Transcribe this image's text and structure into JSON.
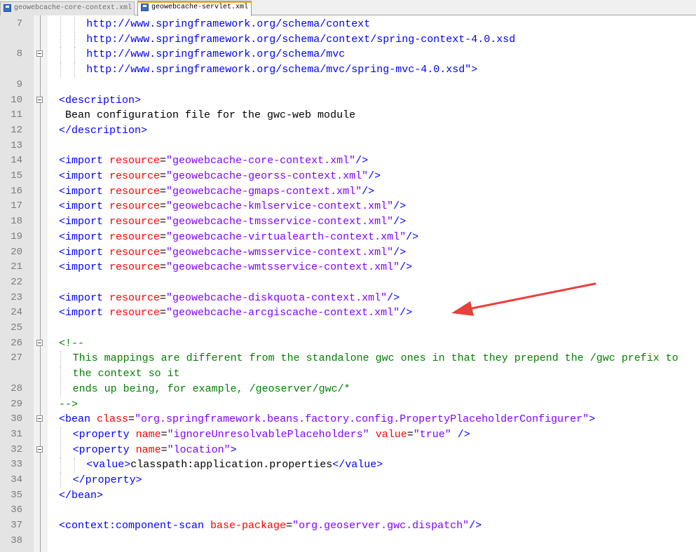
{
  "tabs": [
    {
      "label": "geowebcache-core-context.xml",
      "active": false
    },
    {
      "label": "geowebcache-servlet.xml",
      "active": true
    }
  ],
  "lines": [
    {
      "num": "7",
      "indent": 2,
      "fold": false,
      "spans": [
        {
          "t": "http://www.springframework.org/schema/context",
          "c": "tag"
        }
      ]
    },
    {
      "num": "",
      "indent": 2,
      "fold": false,
      "spans": [
        {
          "t": "http://www.springframework.org/schema/context/spring-context-4.0.xsd",
          "c": "tag"
        }
      ]
    },
    {
      "num": "8",
      "indent": 2,
      "fold": true,
      "spans": [
        {
          "t": "http://www.springframework.org/schema/mvc",
          "c": "tag"
        }
      ]
    },
    {
      "num": "",
      "indent": 2,
      "fold": false,
      "spans": [
        {
          "t": "http://www.springframework.org/schema/mvc/spring-mvc-4.0.xsd\">",
          "c": "tag"
        }
      ]
    },
    {
      "num": "9",
      "indent": 0,
      "fold": false,
      "spans": []
    },
    {
      "num": "10",
      "indent": 0,
      "fold": true,
      "spans": [
        {
          "t": "<description>",
          "c": "tag"
        }
      ]
    },
    {
      "num": "11",
      "indent": 0,
      "fold": false,
      "spans": [
        {
          "t": " Bean configuration file for the gwc-web module",
          "c": "plain"
        }
      ]
    },
    {
      "num": "12",
      "indent": 0,
      "fold": false,
      "spans": [
        {
          "t": "</description>",
          "c": "tag"
        }
      ]
    },
    {
      "num": "13",
      "indent": 0,
      "fold": false,
      "spans": []
    },
    {
      "num": "14",
      "indent": 0,
      "fold": false,
      "spans": [
        {
          "t": "<import ",
          "c": "tag"
        },
        {
          "t": "resource",
          "c": "attr"
        },
        {
          "t": "=",
          "c": "plain"
        },
        {
          "t": "\"geowebcache-core-context.xml\"",
          "c": "val"
        },
        {
          "t": "/>",
          "c": "tag"
        }
      ]
    },
    {
      "num": "15",
      "indent": 0,
      "fold": false,
      "spans": [
        {
          "t": "<import ",
          "c": "tag"
        },
        {
          "t": "resource",
          "c": "attr"
        },
        {
          "t": "=",
          "c": "plain"
        },
        {
          "t": "\"geowebcache-georss-context.xml\"",
          "c": "val"
        },
        {
          "t": "/>",
          "c": "tag"
        }
      ]
    },
    {
      "num": "16",
      "indent": 0,
      "fold": false,
      "spans": [
        {
          "t": "<import ",
          "c": "tag"
        },
        {
          "t": "resource",
          "c": "attr"
        },
        {
          "t": "=",
          "c": "plain"
        },
        {
          "t": "\"geowebcache-gmaps-context.xml\"",
          "c": "val"
        },
        {
          "t": "/>",
          "c": "tag"
        }
      ]
    },
    {
      "num": "17",
      "indent": 0,
      "fold": false,
      "spans": [
        {
          "t": "<import ",
          "c": "tag"
        },
        {
          "t": "resource",
          "c": "attr"
        },
        {
          "t": "=",
          "c": "plain"
        },
        {
          "t": "\"geowebcache-kmlservice-context.xml\"",
          "c": "val"
        },
        {
          "t": "/>",
          "c": "tag"
        }
      ]
    },
    {
      "num": "18",
      "indent": 0,
      "fold": false,
      "spans": [
        {
          "t": "<import ",
          "c": "tag"
        },
        {
          "t": "resource",
          "c": "attr"
        },
        {
          "t": "=",
          "c": "plain"
        },
        {
          "t": "\"geowebcache-tmsservice-context.xml\"",
          "c": "val"
        },
        {
          "t": "/>",
          "c": "tag"
        }
      ]
    },
    {
      "num": "19",
      "indent": 0,
      "fold": false,
      "spans": [
        {
          "t": "<import ",
          "c": "tag"
        },
        {
          "t": "resource",
          "c": "attr"
        },
        {
          "t": "=",
          "c": "plain"
        },
        {
          "t": "\"geowebcache-virtualearth-context.xml\"",
          "c": "val"
        },
        {
          "t": "/>",
          "c": "tag"
        }
      ]
    },
    {
      "num": "20",
      "indent": 0,
      "fold": false,
      "spans": [
        {
          "t": "<import ",
          "c": "tag"
        },
        {
          "t": "resource",
          "c": "attr"
        },
        {
          "t": "=",
          "c": "plain"
        },
        {
          "t": "\"geowebcache-wmsservice-context.xml\"",
          "c": "val"
        },
        {
          "t": "/>",
          "c": "tag"
        }
      ]
    },
    {
      "num": "21",
      "indent": 0,
      "fold": false,
      "spans": [
        {
          "t": "<import ",
          "c": "tag"
        },
        {
          "t": "resource",
          "c": "attr"
        },
        {
          "t": "=",
          "c": "plain"
        },
        {
          "t": "\"geowebcache-wmtsservice-context.xml\"",
          "c": "val"
        },
        {
          "t": "/>",
          "c": "tag"
        }
      ]
    },
    {
      "num": "22",
      "indent": 0,
      "fold": false,
      "spans": []
    },
    {
      "num": "23",
      "indent": 0,
      "fold": false,
      "spans": [
        {
          "t": "<import ",
          "c": "tag"
        },
        {
          "t": "resource",
          "c": "attr"
        },
        {
          "t": "=",
          "c": "plain"
        },
        {
          "t": "\"geowebcache-diskquota-context.xml\"",
          "c": "val"
        },
        {
          "t": "/>",
          "c": "tag"
        }
      ]
    },
    {
      "num": "24",
      "indent": 0,
      "fold": false,
      "spans": [
        {
          "t": "<import ",
          "c": "tag"
        },
        {
          "t": "resource",
          "c": "attr"
        },
        {
          "t": "=",
          "c": "plain"
        },
        {
          "t": "\"geowebcache-arcgiscache-context.xml\"",
          "c": "val"
        },
        {
          "t": "/>",
          "c": "tag"
        }
      ]
    },
    {
      "num": "25",
      "indent": 0,
      "fold": false,
      "spans": []
    },
    {
      "num": "26",
      "indent": 0,
      "fold": true,
      "spans": [
        {
          "t": "<!--",
          "c": "com"
        }
      ]
    },
    {
      "num": "27",
      "indent": 1,
      "fold": false,
      "spans": [
        {
          "t": "This mappings are different from the standalone gwc ones in that they prepend the /gwc prefix to",
          "c": "com"
        }
      ]
    },
    {
      "num": "",
      "indent": 1,
      "fold": false,
      "spans": [
        {
          "t": "the context so it",
          "c": "com"
        }
      ]
    },
    {
      "num": "28",
      "indent": 1,
      "fold": false,
      "spans": [
        {
          "t": "ends up being, for example, /geoserver/gwc/*",
          "c": "com"
        }
      ]
    },
    {
      "num": "29",
      "indent": 0,
      "fold": false,
      "spans": [
        {
          "t": "-->",
          "c": "com"
        }
      ]
    },
    {
      "num": "30",
      "indent": 0,
      "fold": true,
      "spans": [
        {
          "t": "<bean ",
          "c": "tag"
        },
        {
          "t": "class",
          "c": "attr"
        },
        {
          "t": "=",
          "c": "plain"
        },
        {
          "t": "\"org.springframework.beans.factory.config.PropertyPlaceholderConfigurer\"",
          "c": "val"
        },
        {
          "t": ">",
          "c": "tag"
        }
      ]
    },
    {
      "num": "31",
      "indent": 1,
      "fold": false,
      "spans": [
        {
          "t": "<property ",
          "c": "tag"
        },
        {
          "t": "name",
          "c": "attr"
        },
        {
          "t": "=",
          "c": "plain"
        },
        {
          "t": "\"ignoreUnresolvablePlaceholders\"",
          "c": "val"
        },
        {
          "t": " ",
          "c": "plain"
        },
        {
          "t": "value",
          "c": "attr"
        },
        {
          "t": "=",
          "c": "plain"
        },
        {
          "t": "\"true\"",
          "c": "val"
        },
        {
          "t": " />",
          "c": "tag"
        }
      ]
    },
    {
      "num": "32",
      "indent": 1,
      "fold": true,
      "spans": [
        {
          "t": "<property ",
          "c": "tag"
        },
        {
          "t": "name",
          "c": "attr"
        },
        {
          "t": "=",
          "c": "plain"
        },
        {
          "t": "\"location\"",
          "c": "val"
        },
        {
          "t": ">",
          "c": "tag"
        }
      ]
    },
    {
      "num": "33",
      "indent": 2,
      "fold": false,
      "spans": [
        {
          "t": "<value>",
          "c": "tag"
        },
        {
          "t": "classpath:application.properties",
          "c": "plain"
        },
        {
          "t": "</value>",
          "c": "tag"
        }
      ]
    },
    {
      "num": "34",
      "indent": 1,
      "fold": false,
      "spans": [
        {
          "t": "</property>",
          "c": "tag"
        }
      ]
    },
    {
      "num": "35",
      "indent": 0,
      "fold": false,
      "spans": [
        {
          "t": "</bean>",
          "c": "tag"
        }
      ]
    },
    {
      "num": "36",
      "indent": 0,
      "fold": false,
      "spans": []
    },
    {
      "num": "37",
      "indent": 0,
      "fold": false,
      "spans": [
        {
          "t": "<context:component-scan ",
          "c": "tag"
        },
        {
          "t": "base-package",
          "c": "attr"
        },
        {
          "t": "=",
          "c": "plain"
        },
        {
          "t": "\"org.geoserver.gwc.dispatch\"",
          "c": "val"
        },
        {
          "t": "/>",
          "c": "tag"
        }
      ]
    },
    {
      "num": "38",
      "indent": 0,
      "fold": false,
      "spans": []
    }
  ],
  "colors": {
    "tag": "#0000ff",
    "attribute": "#ff0000",
    "value": "#8000ff",
    "comment": "#008000",
    "arrow": "#e8403a"
  }
}
